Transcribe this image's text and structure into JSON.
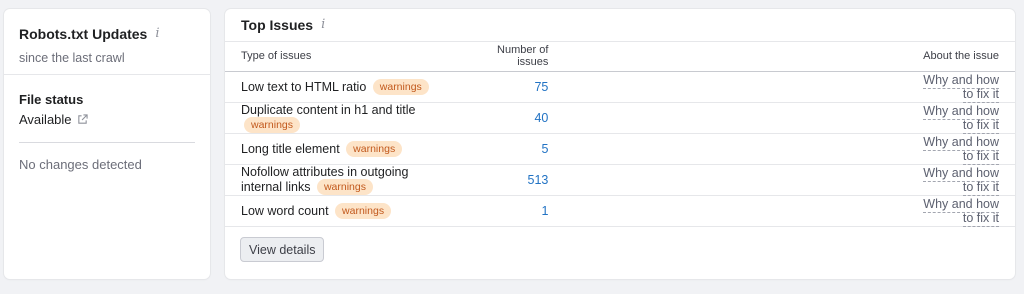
{
  "robots": {
    "title": "Robots.txt Updates",
    "subtitle": "since the last crawl",
    "file_status_label": "File status",
    "file_status_value": "Available",
    "changes_text": "No changes detected"
  },
  "top_issues": {
    "title": "Top Issues",
    "columns": {
      "type": "Type of issues",
      "count": "Number of issues",
      "about": "About the issue"
    },
    "rows": [
      {
        "name": "Low text to HTML ratio",
        "badge": "warnings",
        "count": "75",
        "link": "Why and how to fix it"
      },
      {
        "name": "Duplicate content in h1 and title",
        "badge": "warnings",
        "count": "40",
        "link": "Why and how to fix it"
      },
      {
        "name": "Long title element",
        "badge": "warnings",
        "count": "5",
        "link": "Why and how to fix it"
      },
      {
        "name": "Nofollow attributes in outgoing internal links",
        "badge": "warnings",
        "count": "513",
        "link": "Why and how to fix it"
      },
      {
        "name": "Low word count",
        "badge": "warnings",
        "count": "1",
        "link": "Why and how to fix it"
      }
    ],
    "view_details_label": "View details"
  },
  "colors": {
    "badge_bg": "#fde4c8",
    "badge_text": "#c2591d",
    "count_link": "#2273c4"
  },
  "icons": {
    "info": "info-icon",
    "external_link": "external-link-icon"
  }
}
